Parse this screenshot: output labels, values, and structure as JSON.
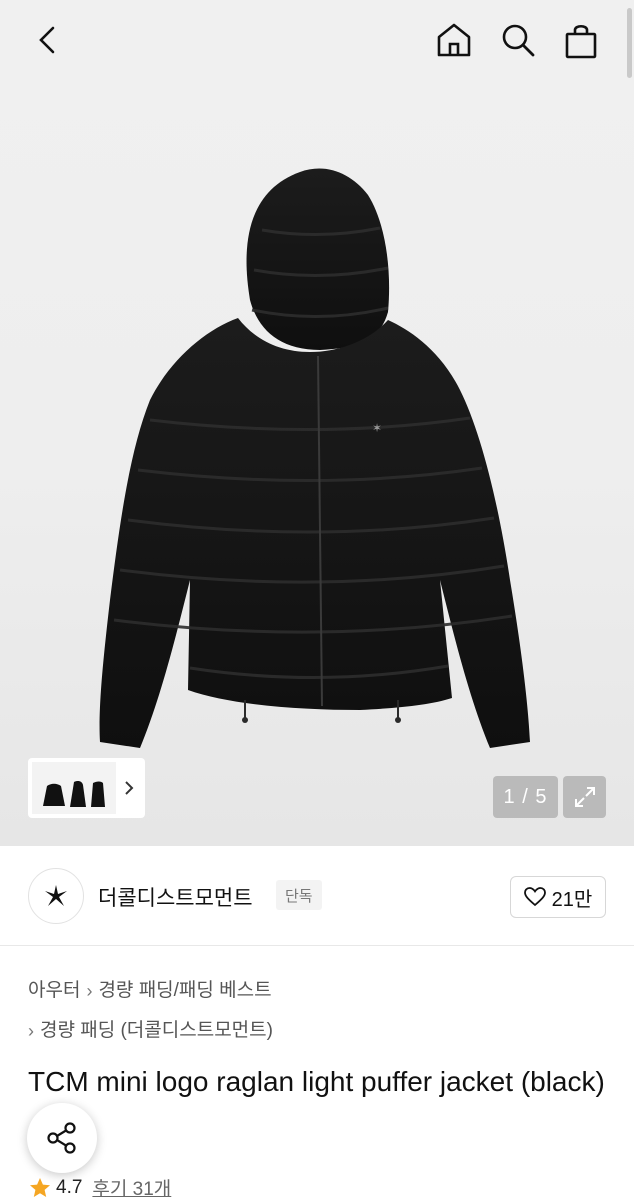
{
  "nav": {
    "icons": [
      "chevron-left-icon",
      "home-icon",
      "search-icon",
      "shopping-bag-icon"
    ]
  },
  "gallery": {
    "counter": "1 / 5",
    "current_image": 1,
    "total_images": 5
  },
  "brand": {
    "name": "더콜디스트모먼트",
    "badge": "단독",
    "likes": "21만"
  },
  "category": {
    "level1": "아우터",
    "level2": "경량 패딩/패딩 베스트",
    "level3": "경량 패딩 (더콜디스트모먼트)"
  },
  "product": {
    "title": "TCM mini logo raglan light puffer jacket (black)"
  },
  "rating": {
    "score": "4.7",
    "reviews": "후기 31개"
  },
  "colors": {
    "star": "#f5a623",
    "accent": "#111111"
  }
}
